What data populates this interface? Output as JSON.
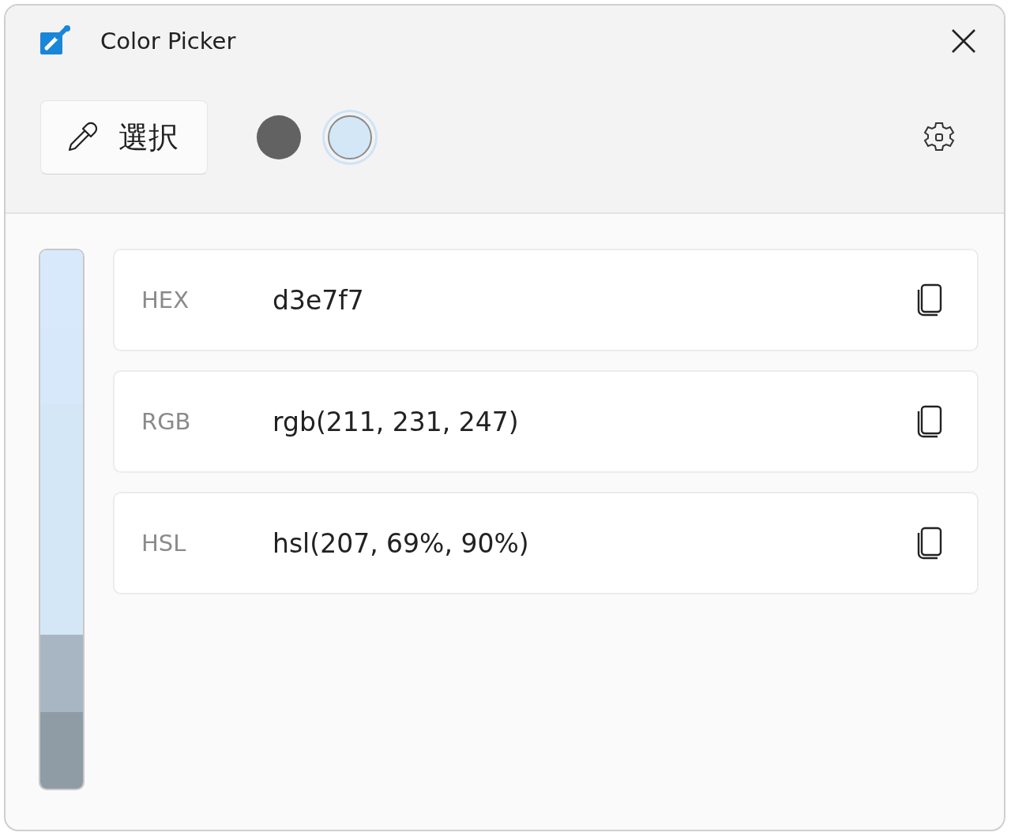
{
  "window": {
    "title": "Color Picker"
  },
  "toolbar": {
    "pick_button": "選択",
    "history": [
      {
        "color": "#626262",
        "selected": false
      },
      {
        "color": "#d3e7f7",
        "selected": true
      }
    ]
  },
  "shades": [
    {
      "color": "#d9e9fc",
      "selected": false
    },
    {
      "color": "#d6e8fa",
      "selected": false
    },
    {
      "color": "#d3e7f7",
      "selected": true
    },
    {
      "color": "#a7b6c2",
      "selected": false
    },
    {
      "color": "#8f9ca6",
      "selected": false
    }
  ],
  "formats": [
    {
      "label": "HEX",
      "value": "d3e7f7"
    },
    {
      "label": "RGB",
      "value": "rgb(211, 231, 247)"
    },
    {
      "label": "HSL",
      "value": "hsl(207, 69%, 90%)"
    }
  ]
}
